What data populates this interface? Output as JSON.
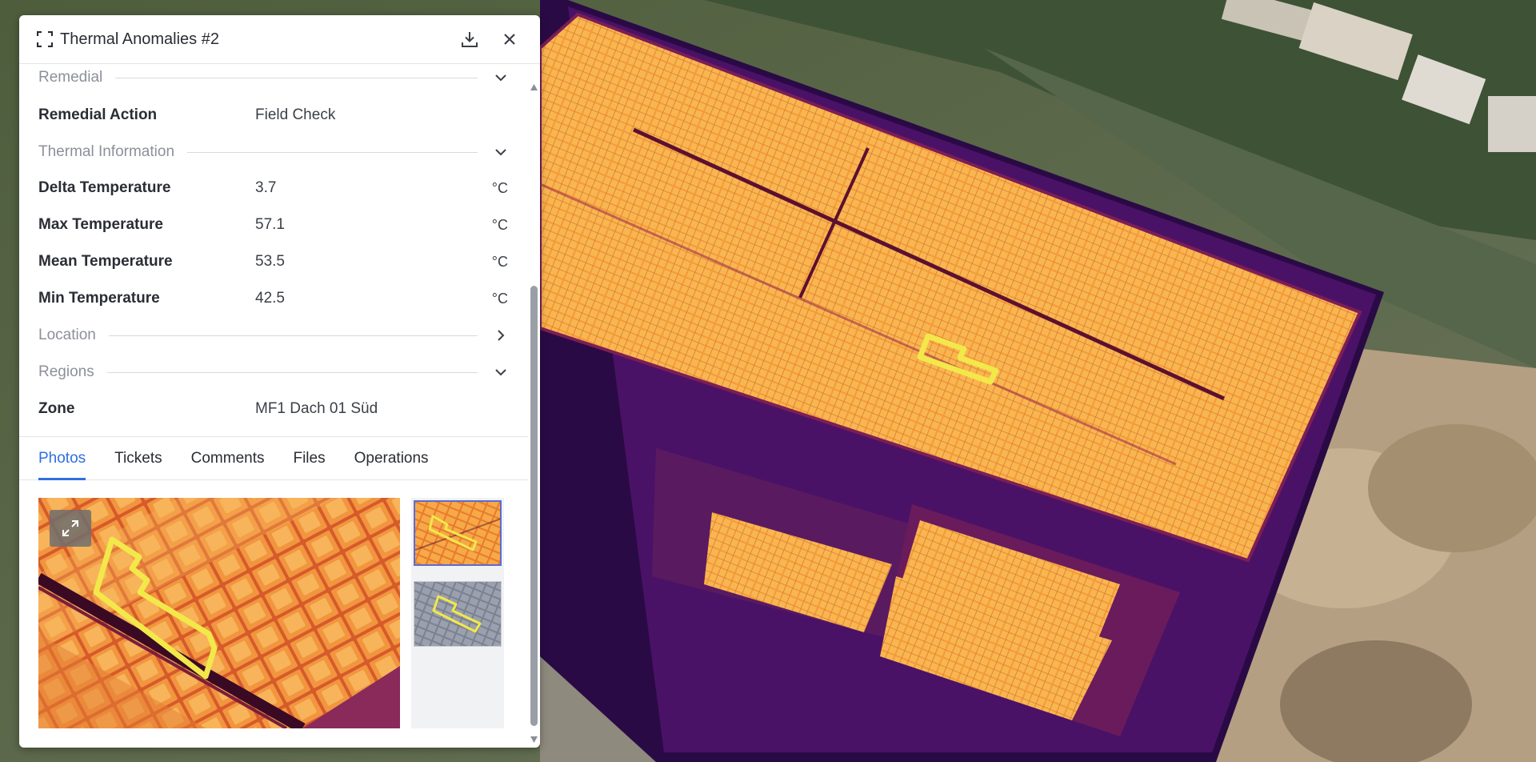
{
  "panel": {
    "title": "Thermal Anomalies #2",
    "icons": {
      "focus": "focus-frame-icon",
      "download": "download-icon",
      "close": "close-icon"
    }
  },
  "sections": {
    "remedial": {
      "label": "Remedial",
      "state": "expanded"
    },
    "thermal": {
      "label": "Thermal Information",
      "state": "expanded"
    },
    "location": {
      "label": "Location",
      "state": "collapsed"
    },
    "regions": {
      "label": "Regions",
      "state": "expanded"
    }
  },
  "fields": {
    "remedial_action": {
      "label": "Remedial Action",
      "value": "Field Check"
    },
    "delta_temp": {
      "label": "Delta Temperature",
      "value": "3.7",
      "unit": "°C"
    },
    "max_temp": {
      "label": "Max Temperature",
      "value": "57.1",
      "unit": "°C"
    },
    "mean_temp": {
      "label": "Mean Temperature",
      "value": "53.5",
      "unit": "°C"
    },
    "min_temp": {
      "label": "Min Temperature",
      "value": "42.5",
      "unit": "°C"
    },
    "zone": {
      "label": "Zone",
      "value": "MF1 Dach 01 Süd"
    }
  },
  "tabs": [
    "Photos",
    "Tickets",
    "Comments",
    "Files",
    "Operations"
  ],
  "active_tab": "Photos",
  "colors": {
    "accent": "#2f6fe0",
    "anomaly_outline": "#f2e84a",
    "thermal_hot": "#f7b24a",
    "thermal_cold": "#3a0c5a"
  }
}
